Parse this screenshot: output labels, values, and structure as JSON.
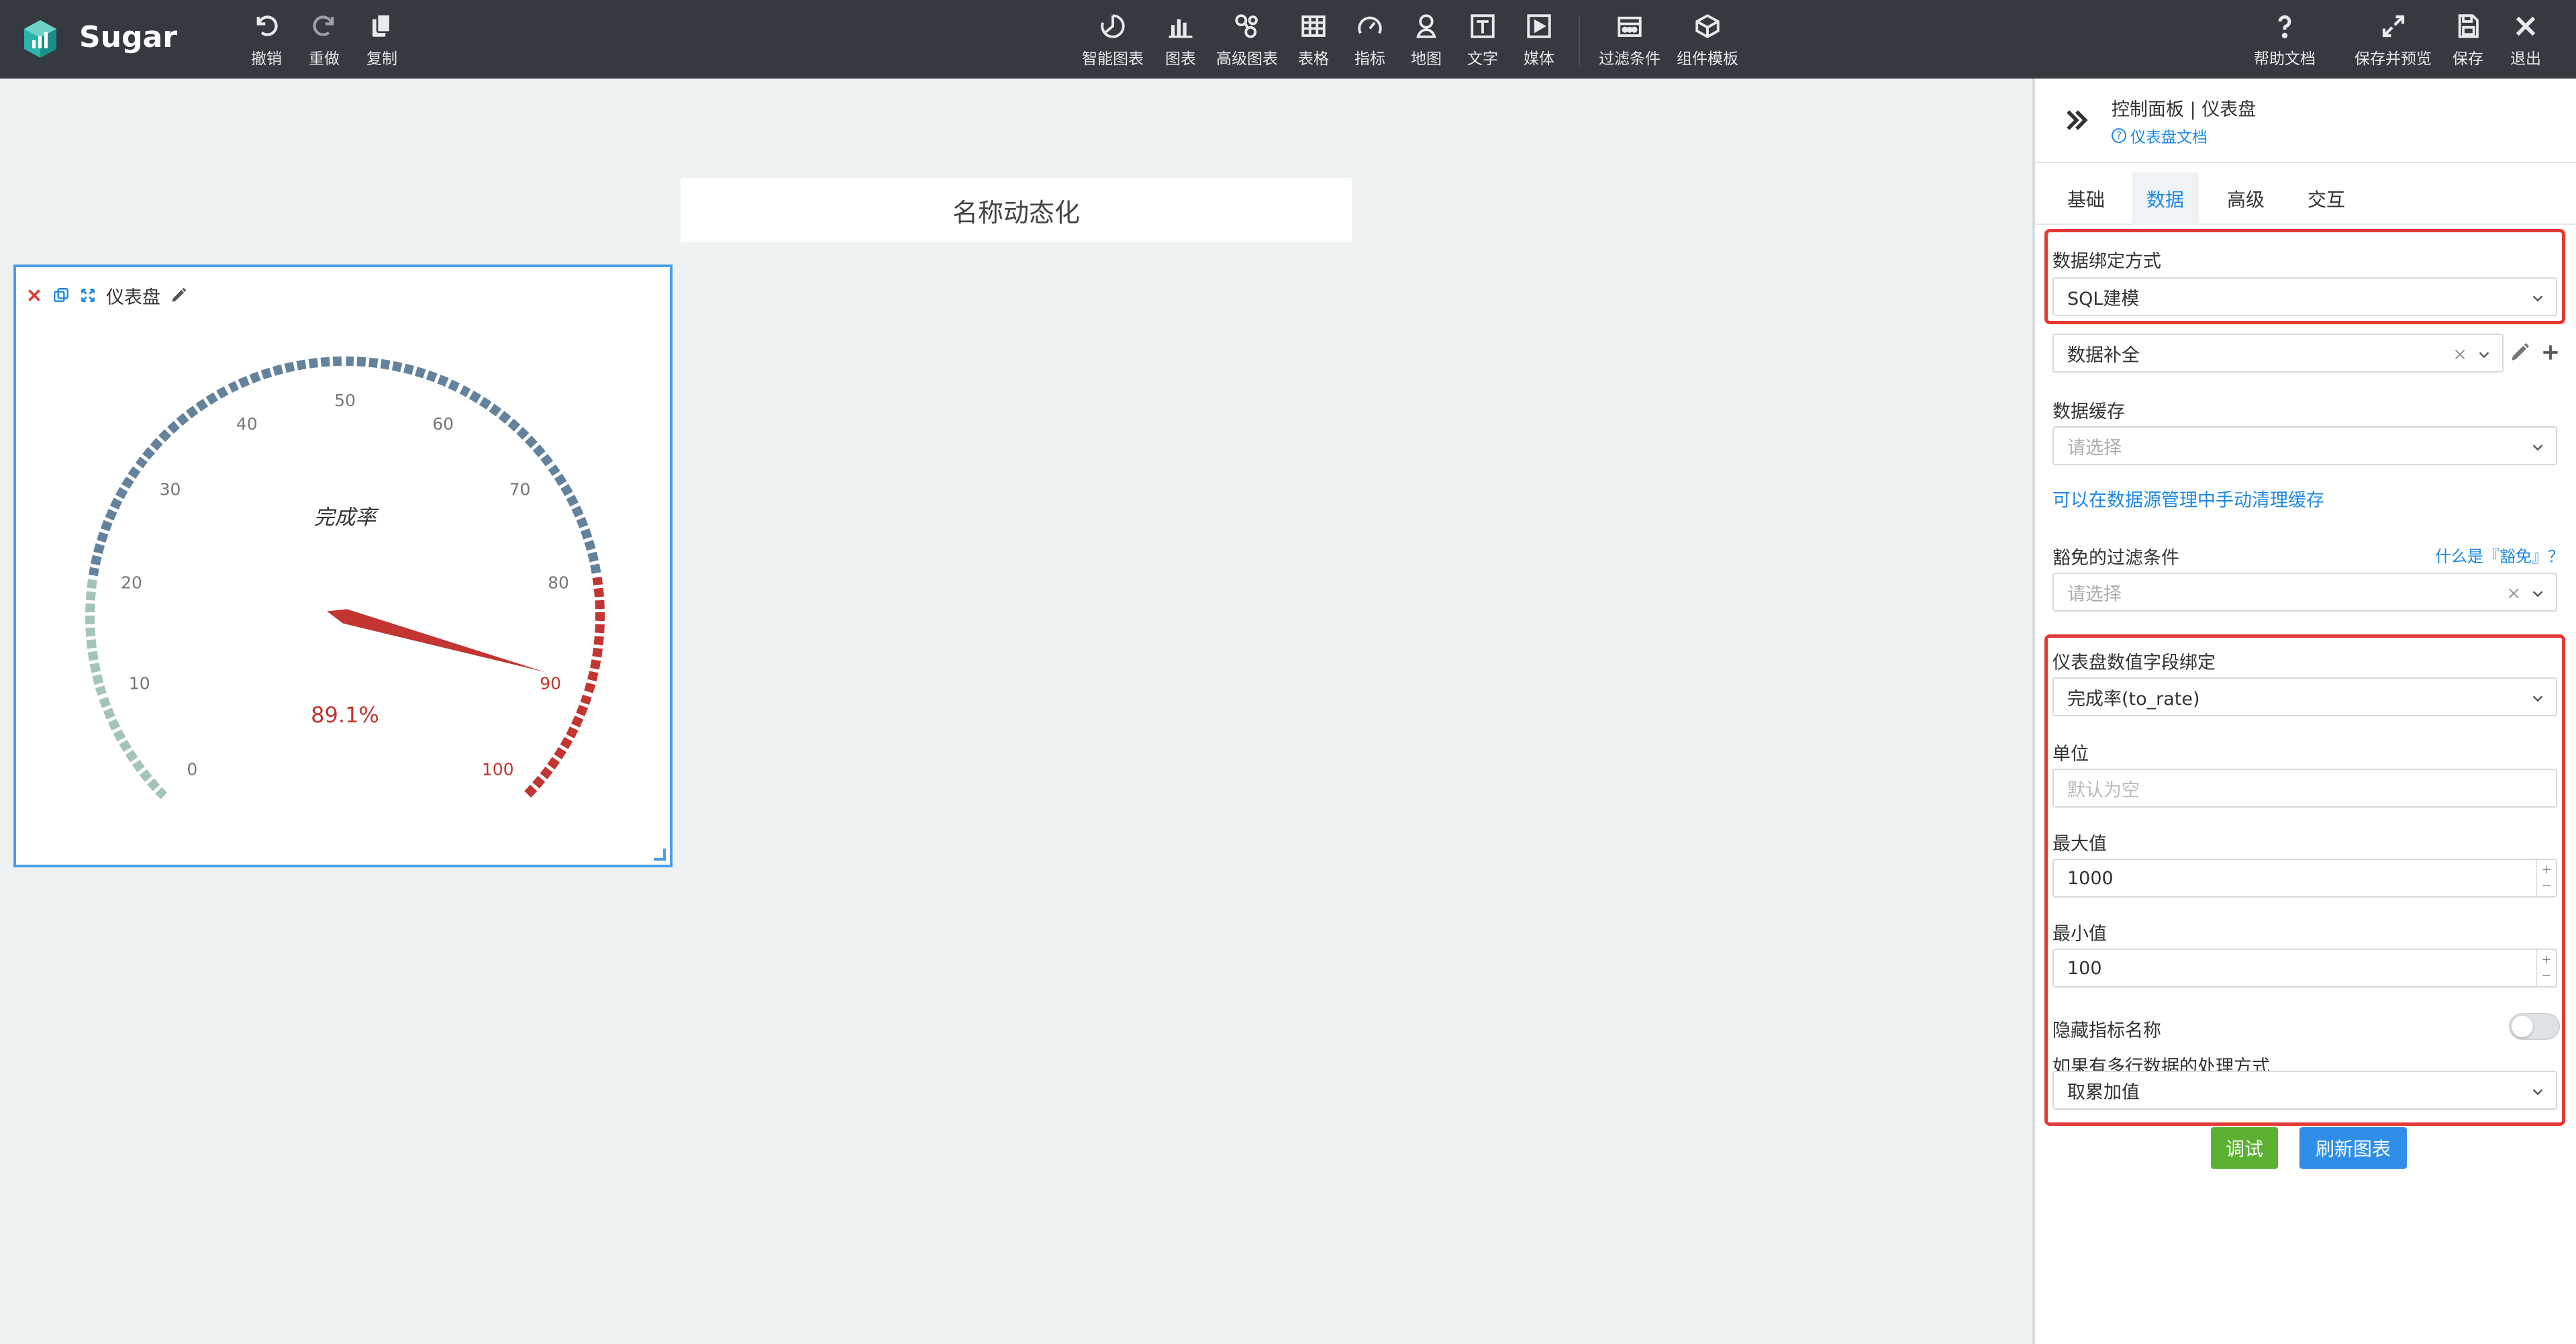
{
  "app": {
    "name": "Sugar"
  },
  "toolbar": {
    "left": [
      {
        "id": "undo",
        "label": "撤销",
        "icon": "undo-icon"
      },
      {
        "id": "redo",
        "label": "重做",
        "icon": "redo-icon"
      },
      {
        "id": "copy",
        "label": "复制",
        "icon": "copy-icon"
      }
    ],
    "center": [
      {
        "id": "smart-chart",
        "label": "智能图表",
        "icon": "smart-chart-icon"
      },
      {
        "id": "chart",
        "label": "图表",
        "icon": "bar-chart-icon"
      },
      {
        "id": "advanced-chart",
        "label": "高级图表",
        "icon": "advanced-chart-icon"
      },
      {
        "id": "table",
        "label": "表格",
        "icon": "table-icon"
      },
      {
        "id": "metric",
        "label": "指标",
        "icon": "gauge-icon"
      },
      {
        "id": "map",
        "label": "地图",
        "icon": "map-pin-icon"
      },
      {
        "id": "text",
        "label": "文字",
        "icon": "text-icon"
      },
      {
        "id": "media",
        "label": "媒体",
        "icon": "media-icon"
      },
      {
        "id": "filter",
        "label": "过滤条件",
        "icon": "filter-icon"
      },
      {
        "id": "template",
        "label": "组件模板",
        "icon": "template-icon"
      }
    ],
    "right": [
      {
        "id": "help",
        "label": "帮助文档",
        "icon": "help-icon"
      },
      {
        "id": "save-preview",
        "label": "保存并预览",
        "icon": "expand-icon"
      },
      {
        "id": "save",
        "label": "保存",
        "icon": "save-icon"
      },
      {
        "id": "exit",
        "label": "退出",
        "icon": "close-icon"
      }
    ]
  },
  "canvas": {
    "title": "名称动态化",
    "widget": {
      "title": "仪表盘",
      "gauge": {
        "name": "完成率",
        "value_text": "89.1%",
        "value": 89.1,
        "min": 0,
        "max": 100,
        "ticks": [
          0,
          10,
          20,
          30,
          40,
          50,
          60,
          70,
          80,
          90,
          100
        ],
        "colors": {
          "low": "#a4c3b9",
          "mid": "#64829b",
          "high": "#c23531"
        },
        "thresholds": [
          0.2,
          0.8
        ]
      }
    }
  },
  "panel": {
    "breadcrumb": "控制面板 | 仪表盘",
    "doc_link": "仪表盘文档",
    "tabs": [
      "基础",
      "数据",
      "高级",
      "交互"
    ],
    "active_tab": "数据",
    "binding_label": "数据绑定方式",
    "binding_value": "SQL建模",
    "dataset_value": "数据补全",
    "cache_label": "数据缓存",
    "cache_placeholder": "请选择",
    "cache_link": "可以在数据源管理中手动清理缓存",
    "exempt_label": "豁免的过滤条件",
    "exempt_help": "什么是『豁免』？",
    "exempt_placeholder": "请选择",
    "field_label": "仪表盘数值字段绑定",
    "field_value": "完成率(to_rate)",
    "unit_label": "单位",
    "unit_placeholder": "默认为空",
    "max_label": "最大值",
    "max_value": "1000",
    "min_label": "最小值",
    "min_value": "100",
    "hide_label": "隐藏指标名称",
    "multi_label": "如果有多行数据的处理方式",
    "multi_value": "取累加值",
    "debug_button": "调试",
    "refresh_button": "刷新图表"
  },
  "colors": {
    "topbar": "#353a40",
    "accent": "#1e88e5",
    "highlight": "#e53935",
    "debug": "#5cb032",
    "refresh": "#2f8fe8"
  }
}
